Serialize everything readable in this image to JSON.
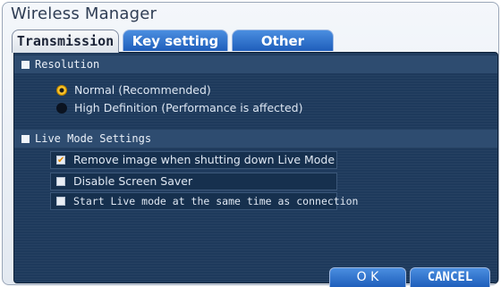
{
  "window": {
    "title": "Wireless Manager"
  },
  "tabs": [
    {
      "label": "Transmission",
      "active": true
    },
    {
      "label": "Key setting",
      "active": false
    },
    {
      "label": "Other",
      "active": false
    }
  ],
  "resolution": {
    "heading": "Resolution",
    "options": [
      {
        "label": "Normal (Recommended)",
        "selected": true
      },
      {
        "label": "High Definition (Performance is affected)",
        "selected": false
      }
    ]
  },
  "live_mode": {
    "heading": "Live Mode Settings",
    "options": [
      {
        "label": "Remove image when shutting down Live Mode",
        "checked": true
      },
      {
        "label": "Disable Screen Saver",
        "checked": false
      },
      {
        "label": "Start Live mode at the same time as connection",
        "checked": false
      }
    ]
  },
  "buttons": {
    "ok": "O K",
    "cancel": "CANCEL"
  },
  "colors": {
    "accent": "#2e6fcf",
    "panel": "#1e3a5c",
    "radio_on": "#ffcc33",
    "check_mark": "#e38a00"
  }
}
